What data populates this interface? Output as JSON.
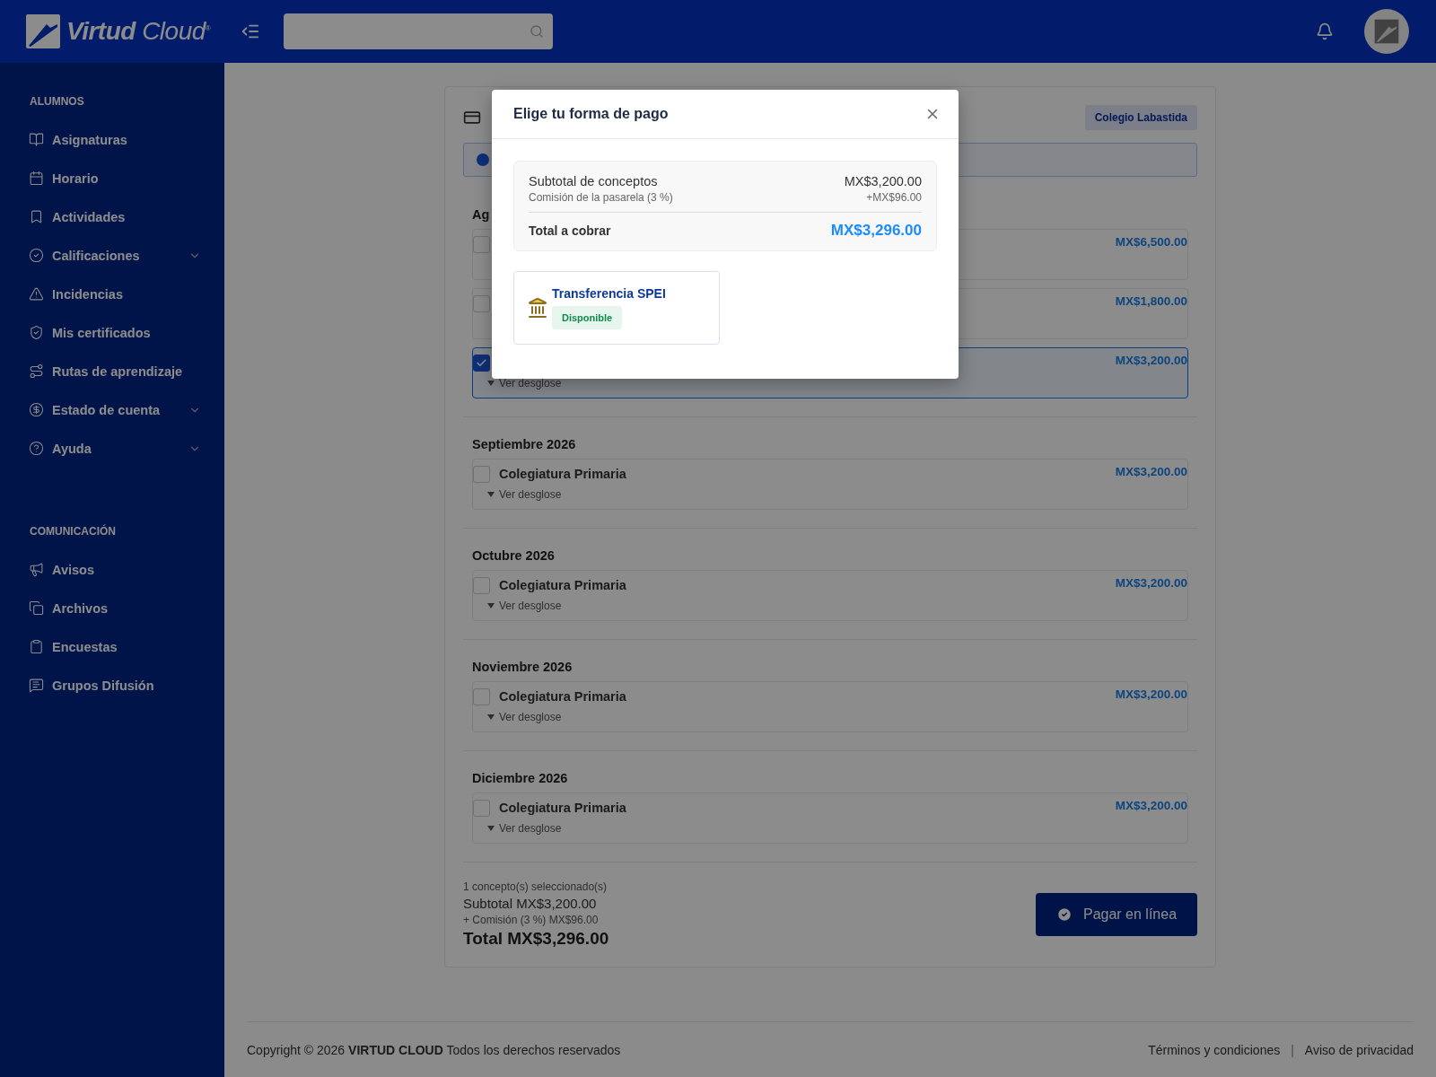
{
  "header": {
    "logo_bold": "Virtud",
    "logo_light": "Cloud",
    "logo_mark": "®"
  },
  "sidebar": {
    "sections": [
      {
        "title": "ALUMNOS",
        "items": [
          {
            "label": "Asignaturas",
            "expandable": false
          },
          {
            "label": "Horario",
            "expandable": false
          },
          {
            "label": "Actividades",
            "expandable": false
          },
          {
            "label": "Calificaciones",
            "expandable": true
          },
          {
            "label": "Incidencias",
            "expandable": false
          },
          {
            "label": "Mis certificados",
            "expandable": false
          },
          {
            "label": "Rutas de aprendizaje",
            "expandable": false
          },
          {
            "label": "Estado de cuenta",
            "expandable": true
          },
          {
            "label": "Ayuda",
            "expandable": true
          }
        ]
      },
      {
        "title": "COMUNICACIÓN",
        "items": [
          {
            "label": "Avisos",
            "expandable": false
          },
          {
            "label": "Archivos",
            "expandable": false
          },
          {
            "label": "Encuestas",
            "expandable": false
          },
          {
            "label": "Grupos Difusión",
            "expandable": false
          }
        ]
      }
    ]
  },
  "card": {
    "badge": "Colegio Labastida",
    "groups": [
      {
        "title": "Ag",
        "items": [
          {
            "amount": "MX$6,500.00",
            "checked": false
          },
          {
            "amount": "MX$1,800.00",
            "checked": false
          },
          {
            "amount": "MX$3,200.00",
            "checked": true,
            "breakdown": "Ver desglose"
          }
        ]
      },
      {
        "title": "Septiembre 2026",
        "items": [
          {
            "name": "Colegiatura Primaria",
            "amount": "MX$3,200.00",
            "checked": false,
            "breakdown": "Ver desglose"
          }
        ]
      },
      {
        "title": "Octubre 2026",
        "items": [
          {
            "name": "Colegiatura Primaria",
            "amount": "MX$3,200.00",
            "checked": false,
            "breakdown": "Ver desglose"
          }
        ]
      },
      {
        "title": "Noviembre 2026",
        "items": [
          {
            "name": "Colegiatura Primaria",
            "amount": "MX$3,200.00",
            "checked": false,
            "breakdown": "Ver desglose"
          }
        ]
      },
      {
        "title": "Diciembre 2026",
        "items": [
          {
            "name": "Colegiatura Primaria",
            "amount": "MX$3,200.00",
            "checked": false,
            "breakdown": "Ver desglose"
          }
        ]
      }
    ],
    "summary": {
      "count": "1 concepto(s) seleccionado(s)",
      "subtotal": "Subtotal MX$3,200.00",
      "fee": "+ Comisión (3 %) MX$96.00",
      "total": "Total MX$3,296.00"
    },
    "pay_button": "Pagar en línea"
  },
  "footer": {
    "copyright": "Copyright © 2026 **VIRTUD CLOUD** Todos los derechos reservados",
    "links": [
      "Términos y condiciones",
      "Aviso de privacidad"
    ],
    "separator": "|"
  },
  "modal": {
    "title": "Elige tu forma de pago",
    "summary": {
      "subtotal_label": "Subtotal de conceptos",
      "subtotal": "MX$3,200.00",
      "fee_label": "Comisión de la pasarela (3 %)",
      "fee": "+MX$96.00",
      "total_label": "Total a cobrar",
      "total": "MX$3,296.00"
    },
    "methods": [
      {
        "name": "Transferencia SPEI",
        "status": "Disponible"
      }
    ]
  }
}
